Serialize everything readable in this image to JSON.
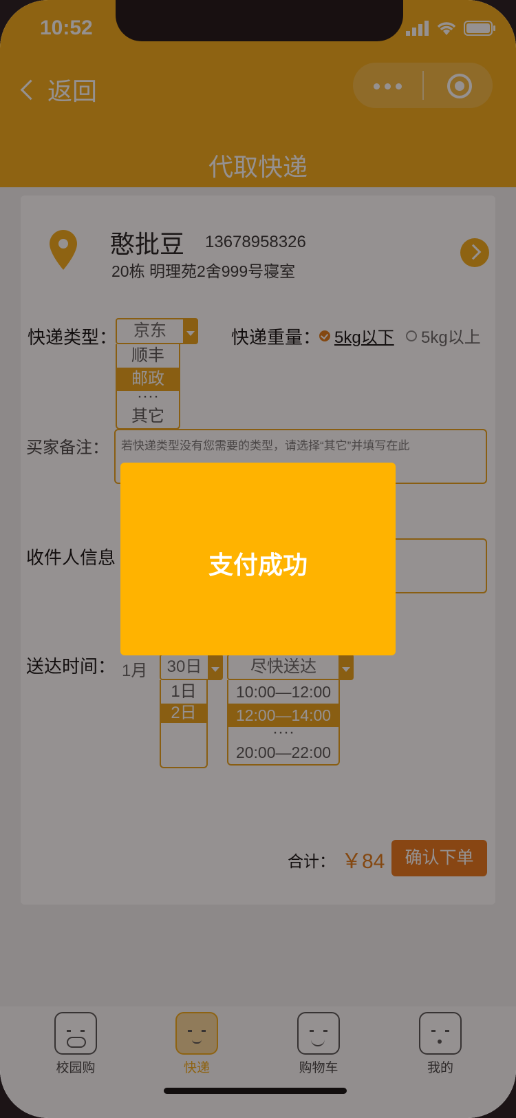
{
  "status_bar": {
    "time": "10:52"
  },
  "nav": {
    "back_label": "返回",
    "title": "代取快递"
  },
  "colors": {
    "accent": "#f3ac19",
    "price": "#e07a16",
    "button": "#e8771a",
    "toast": "#ffb300"
  },
  "address": {
    "name": "憨批豆",
    "phone": "13678958326",
    "detail": "20栋   明理苑2舍999号寝室",
    "icon": "location-pin-icon"
  },
  "form": {
    "express_type": {
      "label": "快递类型：",
      "selected": "京东",
      "options": [
        "顺丰",
        "邮政",
        "····",
        "其它"
      ],
      "highlighted": "邮政"
    },
    "weight": {
      "label": "快递重量：",
      "options": [
        {
          "label": "5kg以下",
          "checked": true
        },
        {
          "label": "5kg以上",
          "checked": false
        }
      ]
    },
    "remark": {
      "label": "买家备注：",
      "placeholder": "若快递类型没有您需要的类型，请选择“其它”并填写在此"
    },
    "receiver": {
      "label": "收件人信息"
    },
    "delivery": {
      "label": "送达时间：",
      "month": "1月",
      "day_selected": "30日",
      "day_options": [
        "1日",
        "2日"
      ],
      "day_highlighted": "2日",
      "slot_selected": "尽快送达",
      "slot_options": [
        "10:00—12:00",
        "12:00—14:00",
        "····",
        "20:00—22:00"
      ],
      "slot_highlighted": "12:00—14:00"
    }
  },
  "footer": {
    "total_label": "合计：",
    "price": "￥84",
    "confirm_label": "确认下单"
  },
  "tabbar": [
    {
      "label": "校园购",
      "icon": "pig-face-icon",
      "active": false
    },
    {
      "label": "快递",
      "icon": "monkey-face-icon",
      "active": true
    },
    {
      "label": "购物车",
      "icon": "sandy-face-icon",
      "active": false
    },
    {
      "label": "我的",
      "icon": "monk-face-icon",
      "active": false
    }
  ],
  "toast": {
    "message": "支付成功"
  }
}
